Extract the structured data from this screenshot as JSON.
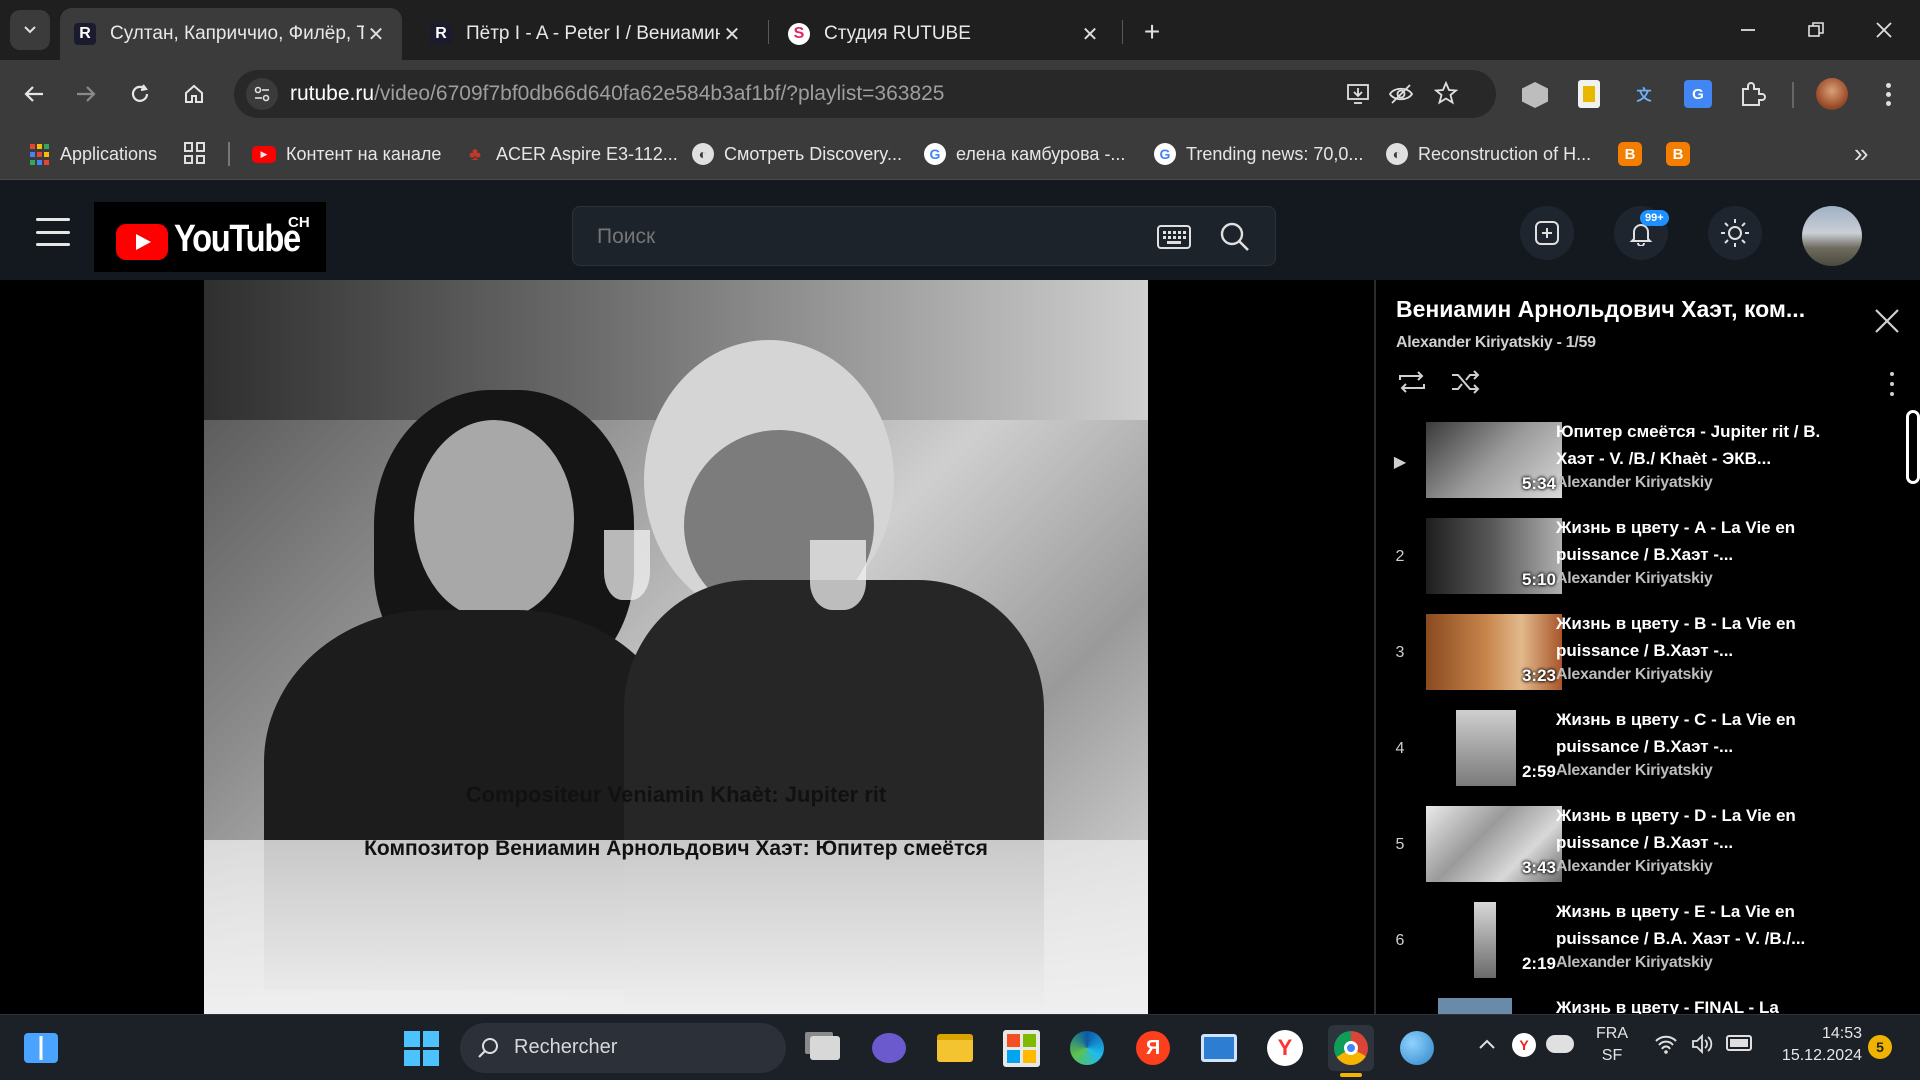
{
  "browser": {
    "tabs": [
      {
        "favicon": "R",
        "title": "Султан, Каприччио, Филёр, Та",
        "active": true
      },
      {
        "favicon": "R",
        "title": "Пётр I - A - Peter I / Вениамин",
        "active": false
      },
      {
        "favicon": "S",
        "title": "Студия RUTUBE",
        "active": false
      }
    ],
    "address": {
      "host": "rutube.ru",
      "path": "/video/6709f7bf0db66d640fa62e584b3af1bf/?playlist=363825"
    },
    "bookmarks": [
      {
        "label": "Applications",
        "icon": "apps-grid-icon"
      },
      {
        "label": "Контент на канале",
        "icon": "youtube-icon"
      },
      {
        "label": "ACER Aspire E3-112...",
        "icon": "acer-icon"
      },
      {
        "label": "Смотреть Discovery...",
        "icon": "globe-icon"
      },
      {
        "label": "елена камбурова -...",
        "icon": "google-icon"
      },
      {
        "label": "Trending news: 70,0...",
        "icon": "google-icon"
      },
      {
        "label": "Reconstruction of H...",
        "icon": "globe-icon"
      }
    ]
  },
  "site": {
    "logo_text": "YouTube",
    "logo_region": "CH",
    "search_placeholder": "Поиск",
    "notification_badge": "99+"
  },
  "video": {
    "caption_line1": "Compositeur Veniamin Khaèt: Jupiter rit",
    "caption_line2": "Композитор Вениамин Арнольдович Хаэт: Юпитер смеётся"
  },
  "playlist": {
    "title": "Вениамин Арнольдович Хаэт, ком...",
    "subtitle": "Alexander Kiriyatskiy - 1/59",
    "items": [
      {
        "num": "▶",
        "duration": "5:34",
        "title": "Юпитер смеётся - Jupiter rit / В. Хаэт - V. /B./ Khaèt - ЭКВ...",
        "author": "Alexander Kiriyatskiy"
      },
      {
        "num": "2",
        "duration": "5:10",
        "title": "Жизнь в цвету - A - La Vie en puissance / В.Хаэт -...",
        "author": "Alexander Kiriyatskiy"
      },
      {
        "num": "3",
        "duration": "3:23",
        "title": "Жизнь в цвету - B - La Vie en puissance / В.Хаэт -...",
        "author": "Alexander Kiriyatskiy"
      },
      {
        "num": "4",
        "duration": "2:59",
        "title": "Жизнь в цвету - C - La Vie en puissance / В.Хаэт -...",
        "author": "Alexander Kiriyatskiy"
      },
      {
        "num": "5",
        "duration": "3:43",
        "title": "Жизнь в цвету - D - La Vie en puissance / В.Хаэт -...",
        "author": "Alexander Kiriyatskiy"
      },
      {
        "num": "6",
        "duration": "2:19",
        "title": "Жизнь в цвету - E - La Vie en puissance / В.А. Хаэт - V. /B./...",
        "author": "Alexander Kiriyatskiy"
      },
      {
        "num": "",
        "duration": "",
        "title": "Жизнь в цвету - FINAL - La",
        "author": ""
      }
    ]
  },
  "taskbar": {
    "search_label": "Rechercher",
    "lang": "FRA",
    "lang2": "SF",
    "time": "14:53",
    "date": "15.12.2024",
    "notification_count": "5"
  },
  "colors": {
    "site_bg": "#14191f",
    "tab_strip": "#1f1f1f",
    "toolbar": "#3b3b3b",
    "youtube_red": "#ff0000",
    "badge": "#1e90ff"
  }
}
